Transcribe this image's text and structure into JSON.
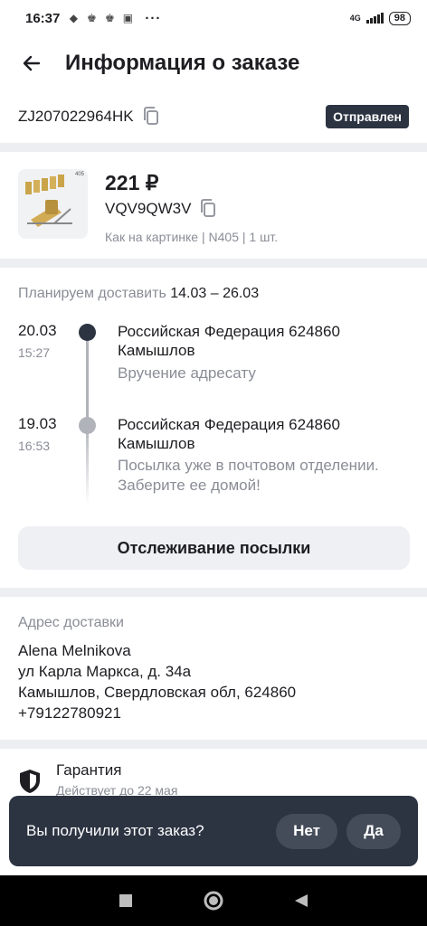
{
  "status_bar": {
    "time": "16:37",
    "network": "4G",
    "battery": "98"
  },
  "header": {
    "title": "Информация о заказе"
  },
  "order": {
    "tracking_number": "ZJ207022964HK",
    "status": "Отправлен"
  },
  "product": {
    "price": "221 ₽",
    "sku": "VQV9QW3V",
    "description": "Как на картинке | N405 | 1 шт.",
    "image_label": "405"
  },
  "delivery": {
    "plan_label": "Планируем доставить",
    "plan_dates": "14.03 – 26.03",
    "events": [
      {
        "date": "20.03",
        "time": "15:27",
        "location": "Российская Федерация 624860 Камышлов",
        "description": "Вручение адресату"
      },
      {
        "date": "19.03",
        "time": "16:53",
        "location": "Российская Федерация 624860 Камышлов",
        "description": "Посылка уже в почтовом отделении. Заберите ее домой!"
      }
    ],
    "track_button": "Отслеживание посылки"
  },
  "address": {
    "title": "Адрес доставки",
    "name": "Alena Melnikova",
    "street": "ул Карла Маркса, д. 34а",
    "city": "Камышлов, Свердловская обл, 624860",
    "phone": "+79122780921"
  },
  "guarantee": {
    "title": "Гарантия",
    "subtitle": "Действует до 22 мая"
  },
  "snackbar": {
    "question": "Вы получили этот заказ?",
    "no": "Нет",
    "yes": "Да"
  },
  "colors": {
    "dark": "#2c3442",
    "muted": "#8a8d96",
    "background": "#eceef1"
  }
}
